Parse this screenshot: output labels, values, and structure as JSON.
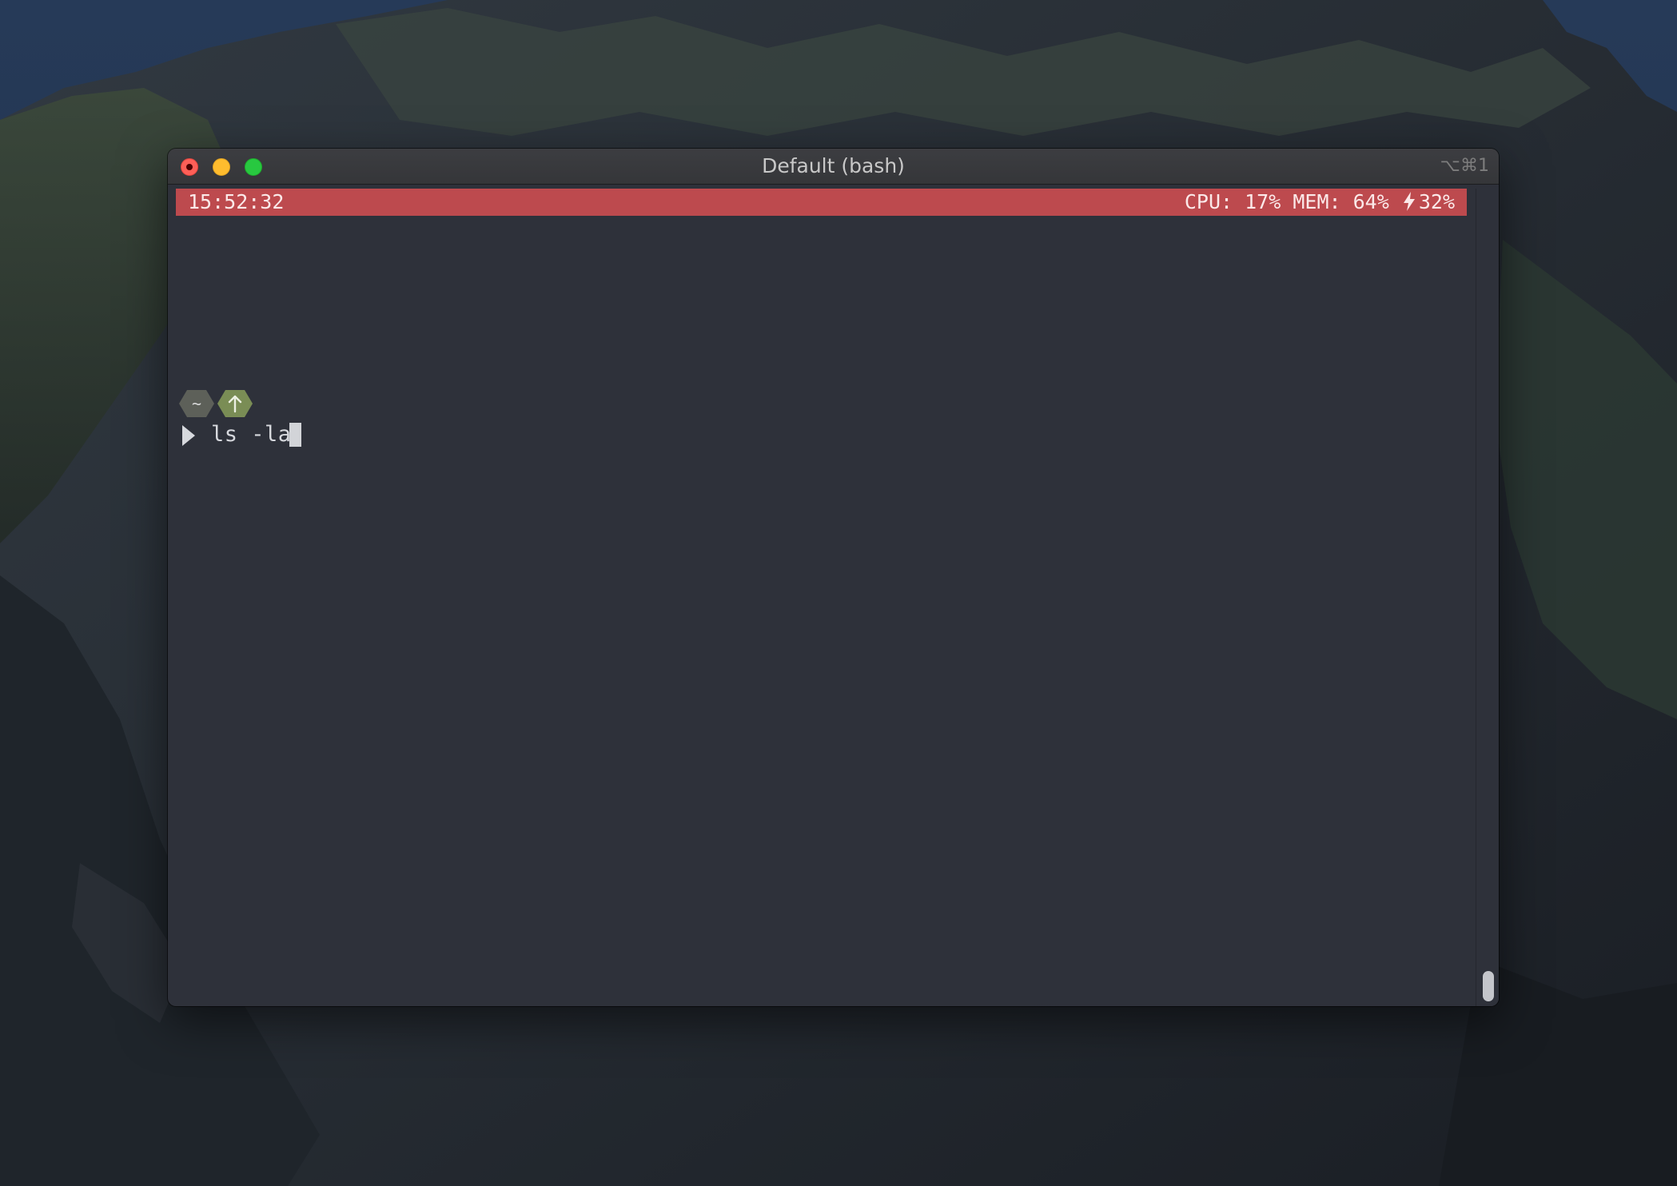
{
  "window": {
    "title": "Default (bash)",
    "shortcut": "⌥⌘1"
  },
  "statusbar": {
    "time": "15:52:32",
    "cpu_label": "CPU:",
    "cpu_value": "17%",
    "mem_label": "MEM:",
    "mem_value": "64%",
    "battery_icon": "lightning-bolt-icon",
    "battery_value": "32%",
    "background_color": "#bd4a4e"
  },
  "prompt": {
    "home_badge": "~",
    "git_badge_icon": "arrow-up-icon",
    "arrow_icon": "prompt-triangle-icon",
    "command": "ls -la"
  },
  "colors": {
    "terminal_background": "#2e313a",
    "home_badge": "#5d6059",
    "git_badge": "#7a8d55",
    "close": "#fe5f57",
    "minimize": "#febc2e",
    "maximize": "#28c840"
  }
}
